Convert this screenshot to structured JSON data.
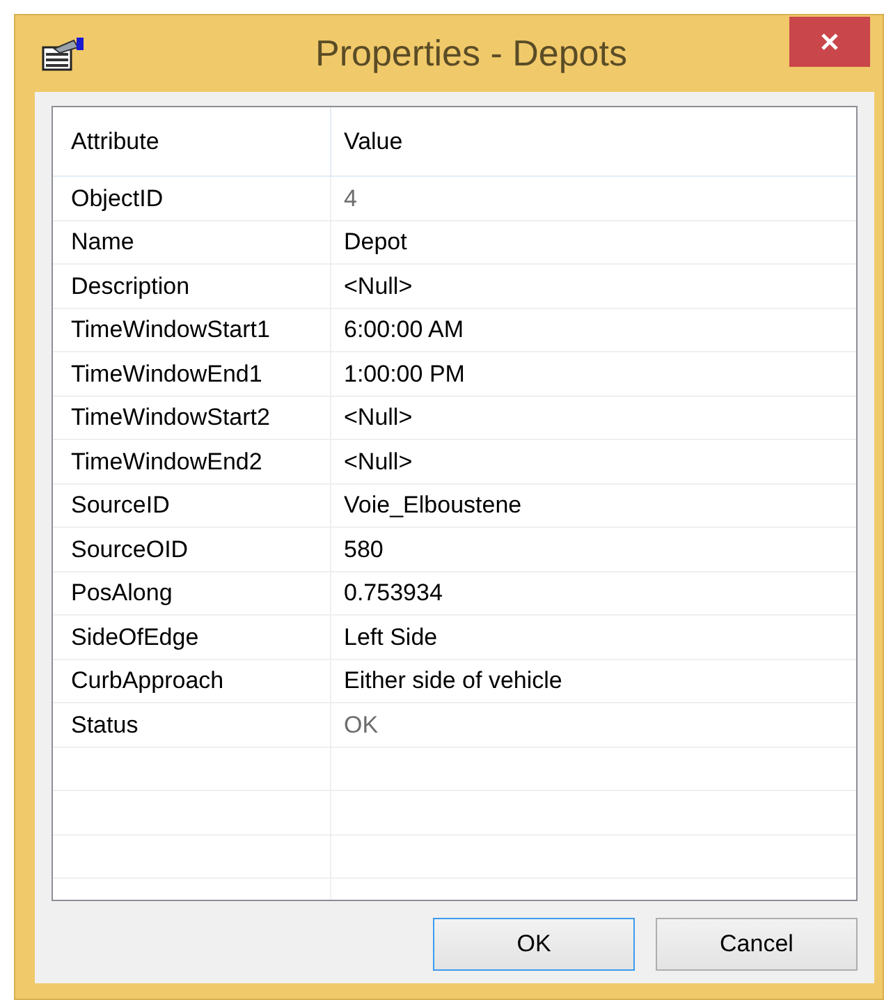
{
  "window": {
    "title": "Properties - Depots"
  },
  "table": {
    "columns": [
      "Attribute",
      "Value"
    ],
    "rows": [
      {
        "attribute": "ObjectID",
        "value": "4",
        "readonly": true
      },
      {
        "attribute": "Name",
        "value": "Depot",
        "readonly": false
      },
      {
        "attribute": "Description",
        "value": "<Null>",
        "readonly": false
      },
      {
        "attribute": "TimeWindowStart1",
        "value": "6:00:00 AM",
        "readonly": false
      },
      {
        "attribute": "TimeWindowEnd1",
        "value": "1:00:00 PM",
        "readonly": false
      },
      {
        "attribute": "TimeWindowStart2",
        "value": "<Null>",
        "readonly": false
      },
      {
        "attribute": "TimeWindowEnd2",
        "value": "<Null>",
        "readonly": false
      },
      {
        "attribute": "SourceID",
        "value": "Voie_Elboustene",
        "readonly": false
      },
      {
        "attribute": "SourceOID",
        "value": "580",
        "readonly": false
      },
      {
        "attribute": "PosAlong",
        "value": "0.753934",
        "readonly": false
      },
      {
        "attribute": "SideOfEdge",
        "value": "Left Side",
        "readonly": false
      },
      {
        "attribute": "CurbApproach",
        "value": "Either side of vehicle",
        "readonly": false
      },
      {
        "attribute": "Status",
        "value": "OK",
        "readonly": true
      }
    ]
  },
  "buttons": [
    {
      "label": "OK",
      "focused": true
    },
    {
      "label": "Cancel",
      "focused": false
    }
  ]
}
